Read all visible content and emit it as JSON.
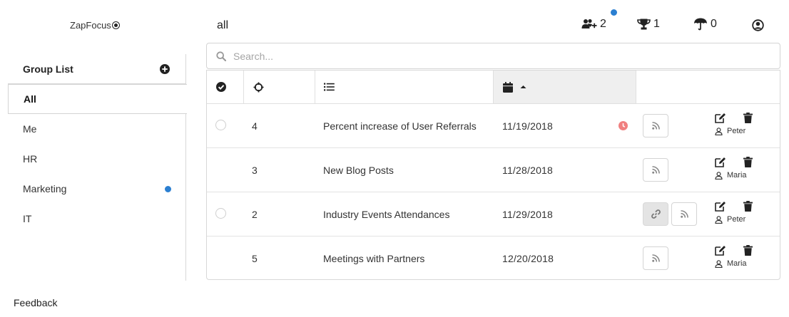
{
  "header": {
    "logo_text": "ZapFocus",
    "page_heading": "all",
    "stats": {
      "users": "2",
      "trophy": "1",
      "umbrella": "0"
    }
  },
  "sidebar": {
    "title": "Group List",
    "items": [
      {
        "label": "All",
        "active": true,
        "dot": false
      },
      {
        "label": "Me",
        "active": false,
        "dot": false
      },
      {
        "label": "HR",
        "active": false,
        "dot": false
      },
      {
        "label": "Marketing",
        "active": false,
        "dot": true
      },
      {
        "label": "IT",
        "active": false,
        "dot": false
      }
    ]
  },
  "footer": {
    "feedback": "Feedback"
  },
  "search": {
    "placeholder": "Search..."
  },
  "table": {
    "rows": [
      {
        "id": "4",
        "name": "Percent increase of User Referrals",
        "date": "11/19/2018",
        "owner": "Peter"
      },
      {
        "id": "3",
        "name": "New Blog Posts",
        "date": "11/28/2018",
        "owner": "Maria"
      },
      {
        "id": "2",
        "name": "Industry Events Attendances",
        "date": "11/29/2018",
        "owner": "Peter"
      },
      {
        "id": "5",
        "name": "Meetings with Partners",
        "date": "12/20/2018",
        "owner": "Maria"
      }
    ]
  },
  "colors": {
    "accent_blue": "#2b7fd1",
    "overdue_red": "#f08080",
    "active_header_bg": "#efefef"
  },
  "icons": [
    "users-plus-icon",
    "trophy-icon",
    "umbrella-icon",
    "user-circle-icon",
    "plus-circle-icon",
    "search-icon",
    "check-circle-icon",
    "crosshairs-icon",
    "list-icon",
    "calendar-icon",
    "sort-asc-icon",
    "clock-icon",
    "rss-icon",
    "link-icon",
    "edit-icon",
    "trash-icon",
    "user-icon"
  ]
}
